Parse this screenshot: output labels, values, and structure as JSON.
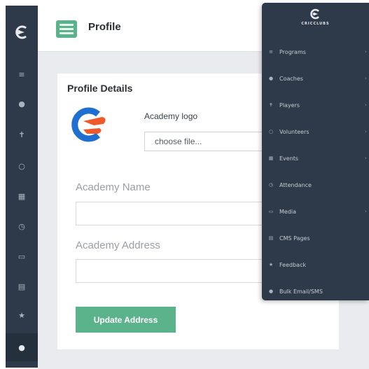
{
  "rail": {
    "items": [
      {
        "icon": "list-icon",
        "glyph": "≡"
      },
      {
        "icon": "user-icon",
        "glyph": "●"
      },
      {
        "icon": "player-icon",
        "glyph": "✝"
      },
      {
        "icon": "hand-icon",
        "glyph": "○"
      },
      {
        "icon": "calendar-icon",
        "glyph": "▦"
      },
      {
        "icon": "clock-icon",
        "glyph": "◷"
      },
      {
        "icon": "image-icon",
        "glyph": "▭"
      },
      {
        "icon": "document-icon",
        "glyph": "▤"
      },
      {
        "icon": "star-icon",
        "glyph": "★"
      },
      {
        "icon": "chat-icon",
        "glyph": "●"
      }
    ]
  },
  "header": {
    "title": "Profile"
  },
  "card": {
    "title": "Profile Details",
    "logo_label": "Academy logo",
    "file_input_value": "choose file...",
    "name_label": "Academy Name",
    "address_label": "Academy Address",
    "update_button": "Update Address"
  },
  "dropdown": {
    "brand": "CRICCLUBS",
    "items": [
      {
        "label": "Programs",
        "icon": "list-icon",
        "glyph": "≡",
        "has_chevron": true
      },
      {
        "label": "Coaches",
        "icon": "user-icon",
        "glyph": "●",
        "has_chevron": true
      },
      {
        "label": "Players",
        "icon": "player-icon",
        "glyph": "✝",
        "has_chevron": true
      },
      {
        "label": "Volunteers",
        "icon": "hand-icon",
        "glyph": "○",
        "has_chevron": true
      },
      {
        "label": "Events",
        "icon": "calendar-icon",
        "glyph": "▦",
        "has_chevron": true
      },
      {
        "label": "Attendance",
        "icon": "clock-icon",
        "glyph": "◷",
        "has_chevron": false
      },
      {
        "label": "Media",
        "icon": "image-icon",
        "glyph": "▭",
        "has_chevron": true
      },
      {
        "label": "CMS Pages",
        "icon": "document-icon",
        "glyph": "▤",
        "has_chevron": false
      },
      {
        "label": "Feedback",
        "icon": "star-icon",
        "glyph": "★",
        "has_chevron": false
      },
      {
        "label": "Bulk Email/SMS",
        "icon": "chat-icon",
        "glyph": "●",
        "has_chevron": false
      }
    ]
  },
  "colors": {
    "accent_green": "#5bb38c",
    "nav_bg": "#2e3a49",
    "logo_blue": "#1f6fd0",
    "logo_orange": "#f05a2a"
  }
}
